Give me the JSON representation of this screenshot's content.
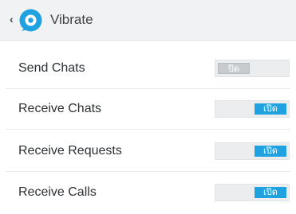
{
  "header": {
    "back_glyph": "‹",
    "title": "Vibrate",
    "logo_icon": "chat-bubble-logo-icon",
    "logo_color": "#1fa2df"
  },
  "settings": [
    {
      "label": "Send Chats",
      "state": "off",
      "toggle_text": "ปิด"
    },
    {
      "label": "Receive Chats",
      "state": "on",
      "toggle_text": "เปิด"
    },
    {
      "label": "Receive Requests",
      "state": "on",
      "toggle_text": "เปิด"
    },
    {
      "label": "Receive Calls",
      "state": "on",
      "toggle_text": "เปิด"
    }
  ],
  "colors": {
    "accent": "#1fa2df",
    "toggle_off": "#c7cbce",
    "header_bg": "#f1f2f3"
  }
}
